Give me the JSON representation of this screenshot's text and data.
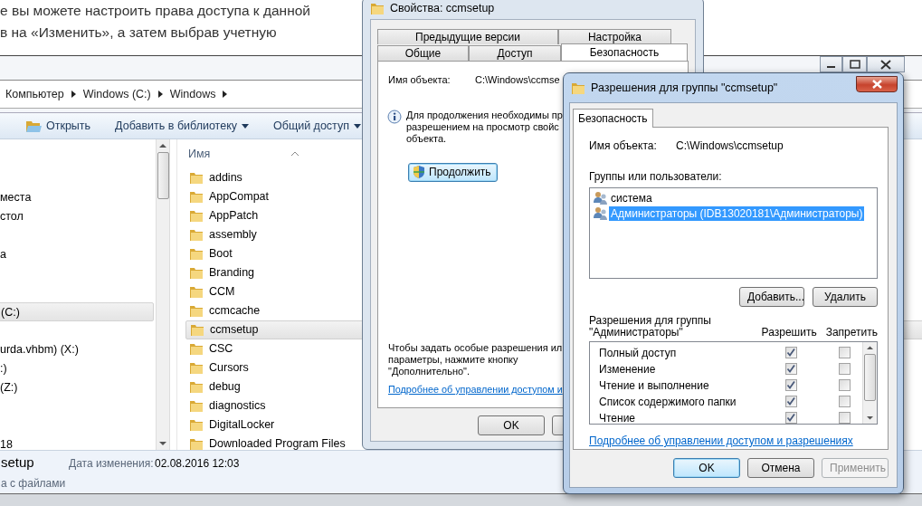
{
  "article": {
    "lines": [
      "е вы можете настроить права доступа к данной",
      "в на «Изменить», а затем выбрав учетную"
    ]
  },
  "explorer": {
    "breadcrumb": [
      "Компьютер",
      "Windows (C:)",
      "Windows"
    ],
    "toolbar": [
      {
        "label": "Открыть",
        "kind": "open"
      },
      {
        "label": "Добавить в библиотеку",
        "kind": "menu"
      },
      {
        "label": "Общий доступ",
        "kind": "menu"
      }
    ],
    "nav_items": [
      {
        "label": "места",
        "selected": false
      },
      {
        "label": "стол",
        "selected": false
      },
      {
        "label": "а",
        "selected": false
      },
      {
        "label": "(C:)",
        "selected": true
      },
      {
        "label": "urda.vhbm) (X:)",
        "selected": false
      },
      {
        "label": ":)",
        "selected": false
      },
      {
        "label": "(Z:)",
        "selected": false
      },
      {
        "label": "18",
        "selected": false
      }
    ],
    "column": "Имя",
    "files": [
      {
        "name": "addins",
        "selected": false
      },
      {
        "name": "AppCompat",
        "selected": false
      },
      {
        "name": "AppPatch",
        "selected": false
      },
      {
        "name": "assembly",
        "selected": false
      },
      {
        "name": "Boot",
        "selected": false
      },
      {
        "name": "Branding",
        "selected": false
      },
      {
        "name": "CCM",
        "selected": false
      },
      {
        "name": "ccmcache",
        "selected": false
      },
      {
        "name": "ccmsetup",
        "selected": true
      },
      {
        "name": "CSC",
        "selected": false
      },
      {
        "name": "Cursors",
        "selected": false
      },
      {
        "name": "debug",
        "selected": false
      },
      {
        "name": "diagnostics",
        "selected": false
      },
      {
        "name": "DigitalLocker",
        "selected": false
      },
      {
        "name": "Downloaded Program Files",
        "selected": false
      }
    ],
    "details": {
      "name": "setup",
      "type": "а с файлами",
      "modified_label": "Дата изменения:",
      "modified_value": "02.08.2016 12:03"
    }
  },
  "properties": {
    "title": "Свойства: ccmsetup",
    "tab_rows": [
      [
        {
          "label": "Предыдущие версии",
          "selected": false
        },
        {
          "label": "Настройка",
          "selected": false
        }
      ],
      [
        {
          "label": "Общие",
          "selected": false
        },
        {
          "label": "Доступ",
          "selected": false
        },
        {
          "label": "Безопасность",
          "selected": true
        }
      ]
    ],
    "object_label": "Имя объекта:",
    "object_value": "C:\\Windows\\ccmse",
    "info_lines": [
      "Для продолжения необходимы пр",
      "разрешением на просмотр свойс",
      "объекта."
    ],
    "continue_button": "Продолжить",
    "footer_lines": [
      "Чтобы задать особые разрешения ил",
      "параметры, нажмите кнопку",
      "\"Дополнительно\"."
    ],
    "link": "Подробнее об управлении доступом и",
    "buttons": [
      "OK"
    ]
  },
  "permissions": {
    "title": "Разрешения для группы \"ccmsetup\"",
    "tabs": [
      {
        "label": "Безопасность",
        "selected": true
      }
    ],
    "object_label": "Имя объекта:",
    "object_value": "C:\\Windows\\ccmsetup",
    "groups_label": "Группы или пользователи:",
    "groups": [
      {
        "name": "система",
        "selected": false
      },
      {
        "name": "Администраторы (IDB13020181\\Администраторы)",
        "selected": true
      }
    ],
    "group_buttons": [
      "Добавить...",
      "Удалить"
    ],
    "perm_label": "Разрешения для группы \"Администраторы\"",
    "columns": [
      "Разрешить",
      "Запретить"
    ],
    "rows": [
      {
        "name": "Полный доступ",
        "allow": true,
        "deny": false
      },
      {
        "name": "Изменение",
        "allow": true,
        "deny": false
      },
      {
        "name": "Чтение и выполнение",
        "allow": true,
        "deny": false
      },
      {
        "name": "Список содержимого папки",
        "allow": true,
        "deny": false
      },
      {
        "name": "Чтение",
        "allow": true,
        "deny": false
      }
    ],
    "link": "Подробнее об управлении доступом и разрешениях",
    "buttons": [
      {
        "label": "OK",
        "default": true,
        "disabled": false
      },
      {
        "label": "Отмена",
        "default": false,
        "disabled": false
      },
      {
        "label": "Применить",
        "default": false,
        "disabled": true
      }
    ]
  }
}
